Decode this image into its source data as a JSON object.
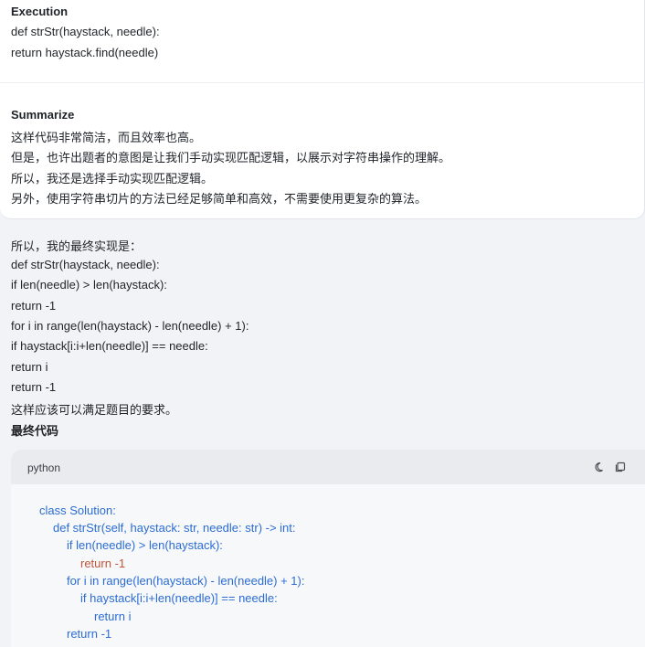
{
  "execution": {
    "title": "Execution",
    "lines": [
      "def strStr(haystack, needle):",
      "return haystack.find(needle)"
    ]
  },
  "summarize": {
    "title": "Summarize",
    "lines": [
      "这样代码非常简洁，而且效率也高。",
      "但是，也许出题者的意图是让我们手动实现匹配逻辑，以展示对字符串操作的理解。",
      "所以，我还是选择手动实现匹配逻辑。",
      "另外，使用字符串切片的方法已经足够简单和高效，不需要使用更复杂的算法。"
    ]
  },
  "answer": {
    "lines": [
      "所以，我的最终实现是：",
      "def strStr(haystack, needle):",
      "if len(needle) > len(haystack):",
      "return -1",
      "for i in range(len(haystack) - len(needle) + 1):",
      "if haystack[i:i+len(needle)] == needle:",
      "return i",
      "return -1",
      "这样应该可以满足题目的要求。"
    ],
    "final_heading": "最终代码"
  },
  "code": {
    "language": "python",
    "lines": [
      "class Solution:",
      "def strStr(self, haystack: str, needle: str) -> int:",
      "if len(needle) > len(haystack):",
      "return -1",
      "for i in range(len(haystack) - len(needle) + 1):",
      "if haystack[i:i+len(needle)] == needle:",
      "return i",
      "return -1"
    ],
    "icons": [
      "moon-icon",
      "copy-icon"
    ]
  }
}
